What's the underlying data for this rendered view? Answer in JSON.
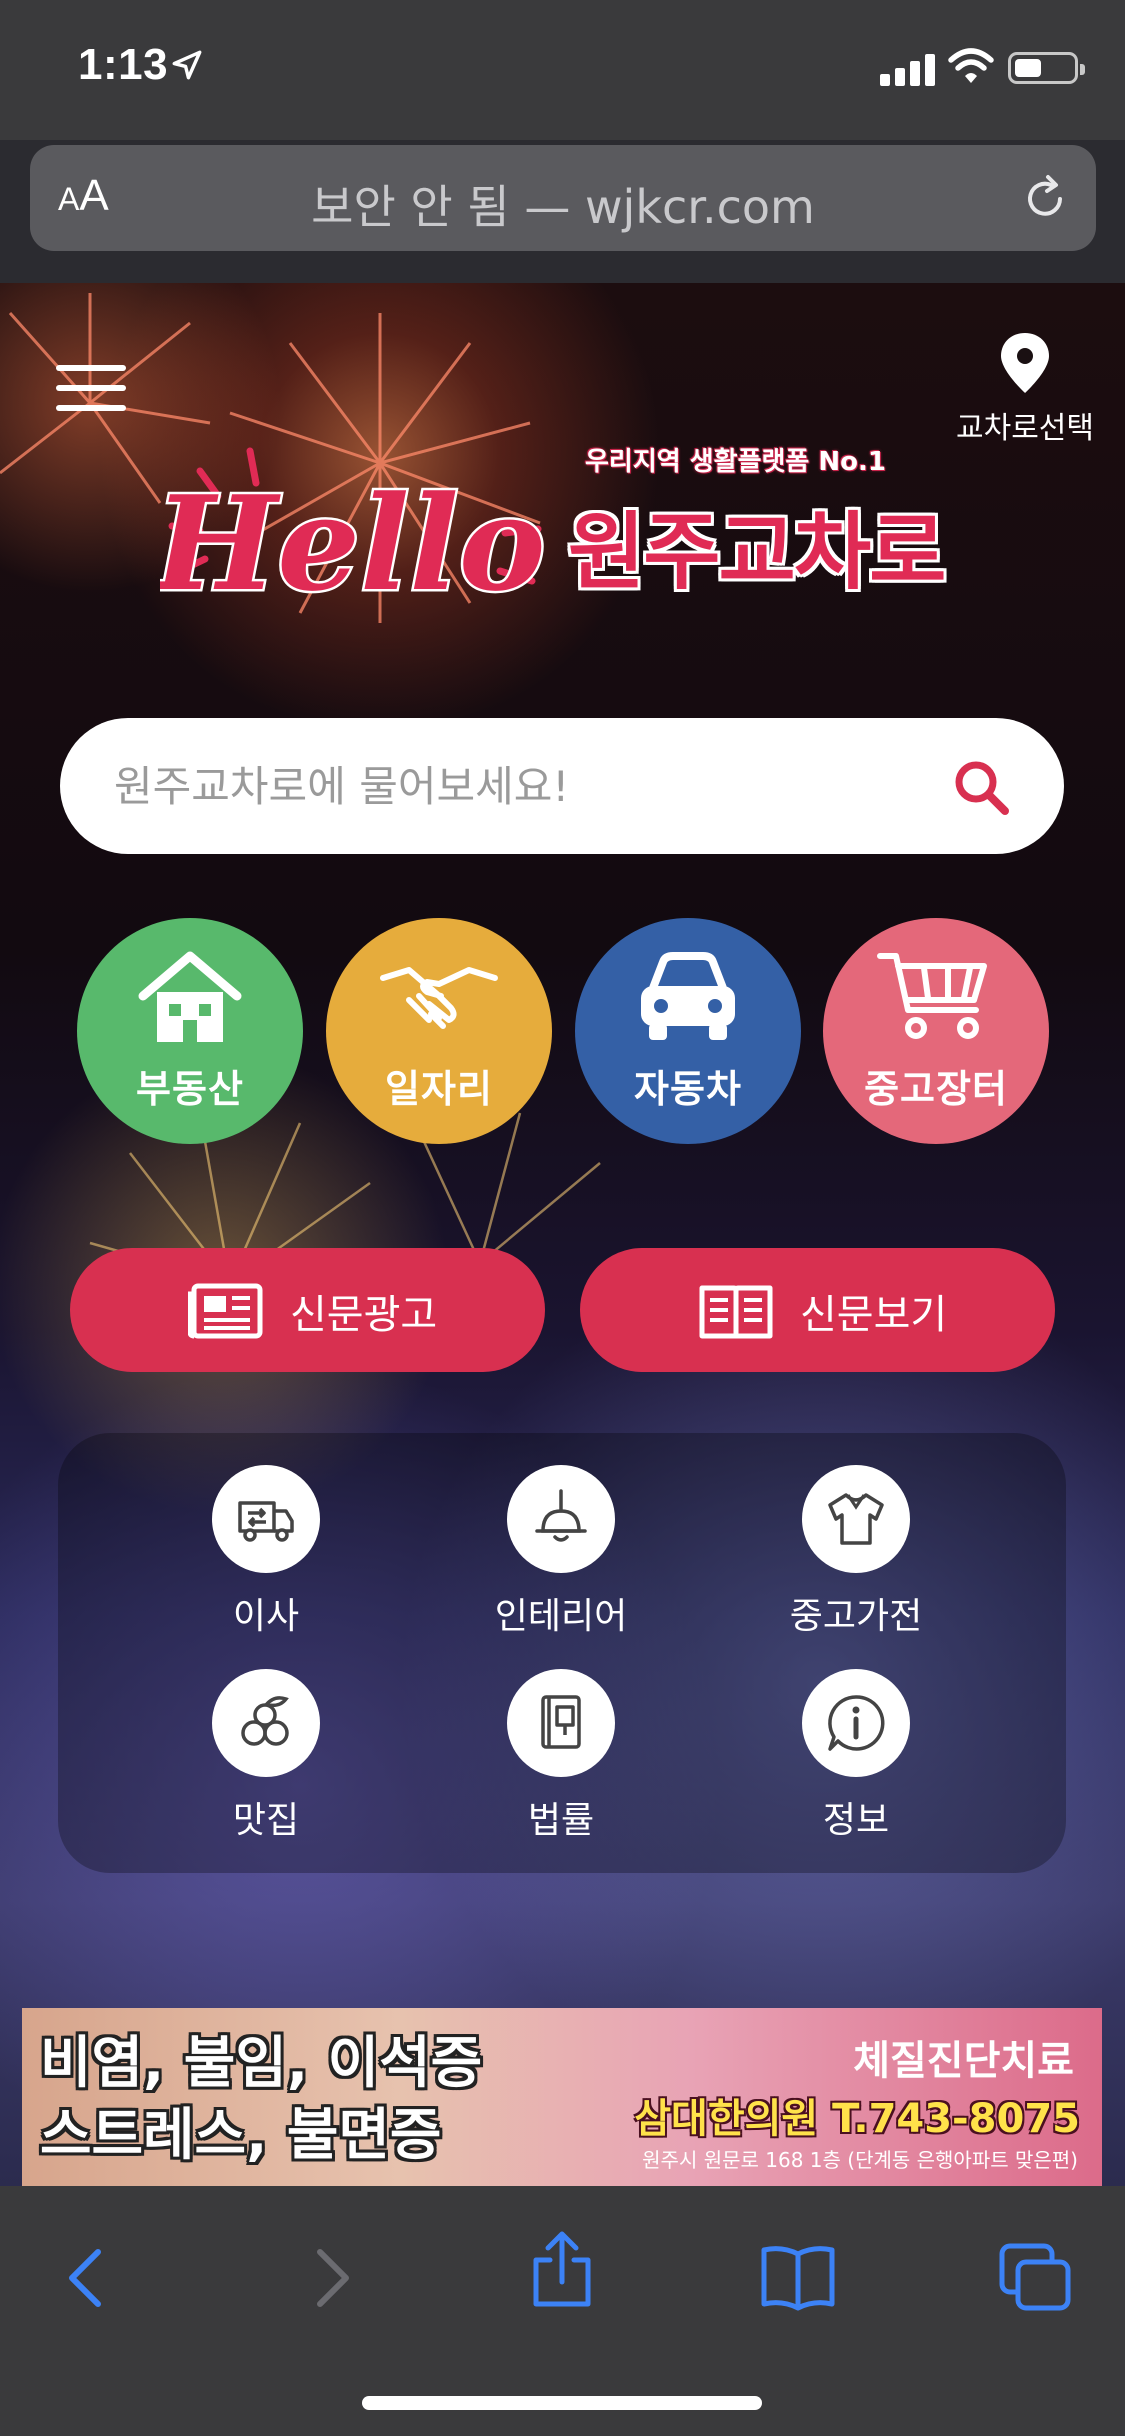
{
  "status_bar": {
    "time": "1:13"
  },
  "url_bar": {
    "aa_small": "A",
    "aa_large": "A",
    "text": "보안 안 됨 — wjkcr.com"
  },
  "header": {
    "location_label": "교차로선택",
    "logo_tagline": "우리지역 생활플랫폼 No.1",
    "logo_hello": "Hello",
    "logo_name": "원주교차로"
  },
  "search": {
    "placeholder": "원주교차로에 물어보세요!"
  },
  "categories": [
    {
      "label": "부동산",
      "color": "#58b96c"
    },
    {
      "label": "일자리",
      "color": "#e6ac3c"
    },
    {
      "label": "자동차",
      "color": "#3460a6"
    },
    {
      "label": "중고장터",
      "color": "#e4687a"
    }
  ],
  "paper_buttons": [
    {
      "label": "신문광고"
    },
    {
      "label": "신문보기"
    }
  ],
  "services": [
    {
      "label": "이사"
    },
    {
      "label": "인테리어"
    },
    {
      "label": "중고가전"
    },
    {
      "label": "맛집"
    },
    {
      "label": "법률"
    },
    {
      "label": "정보"
    }
  ],
  "ad": {
    "line1": "비염, 불임, 이석증",
    "line2": "스트레스, 불면증",
    "headline": "체질진단치료",
    "clinic": "삼대한의원 T.743-8075",
    "address": "원주시 원문로 168 1층 (단계동 은행아파트 맞은편)"
  },
  "colors": {
    "accent": "#d83050",
    "search_icon": "#d83050"
  }
}
